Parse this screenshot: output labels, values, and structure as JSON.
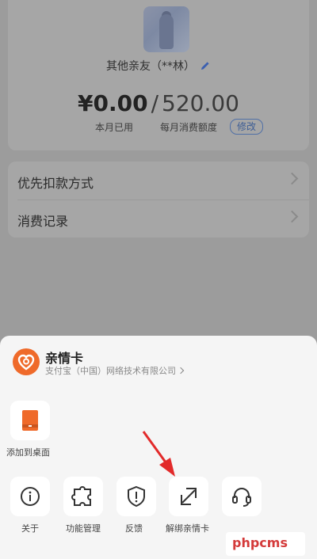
{
  "background": {
    "friend_name": "其他亲友（**林）",
    "used_amount": "¥0.00",
    "slash": "/",
    "limit_amount": "520.00",
    "used_label": "本月已用",
    "limit_label": "每月消费额度",
    "modify_label": "修改",
    "menu": [
      {
        "label": "优先扣款方式"
      },
      {
        "label": "消费记录"
      }
    ]
  },
  "sheet": {
    "app_title": "亲情卡",
    "app_company": "支付宝（中国）网络技术有限公司",
    "actions_top": [
      {
        "label": "添加到桌面",
        "icon": "desktop-card-icon"
      }
    ],
    "actions_bottom": [
      {
        "label": "关于",
        "icon": "info-icon"
      },
      {
        "label": "功能管理",
        "icon": "puzzle-icon"
      },
      {
        "label": "反馈",
        "icon": "shield-alert-icon"
      },
      {
        "label": "解绑亲情卡",
        "icon": "unlink-icon"
      },
      {
        "label": "",
        "icon": "headset-icon"
      }
    ]
  },
  "watermark": "phpcms",
  "colors": {
    "accent_orange": "#ef6a2a",
    "arrow_red": "#e22a2a",
    "modify_blue": "#3d5d95"
  }
}
